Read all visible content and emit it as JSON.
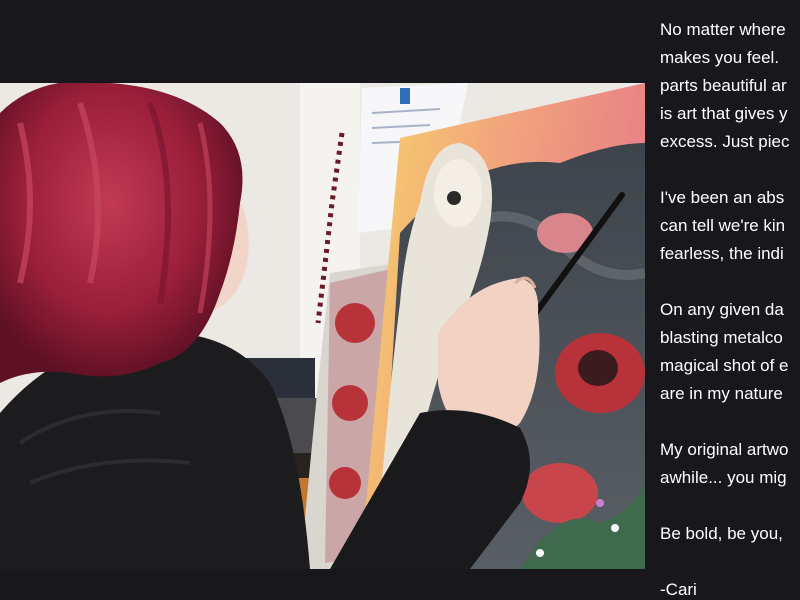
{
  "bio": {
    "paragraphs": [
      [
        "No matter where",
        "makes you feel.",
        "parts beautiful ar",
        "is art that gives y",
        "excess. Just piec"
      ],
      [
        "I've been an abs",
        "can tell we're kin",
        "fearless, the indi"
      ],
      [
        "On any given da",
        "blasting metalco",
        "magical shot of e",
        "are in my nature"
      ],
      [
        "My original artwo",
        "awhile... you mig"
      ],
      [
        "Be bold, be you,"
      ]
    ],
    "signature": "-Cari"
  },
  "photo": {
    "subject": "artist-painting-owl-canvas",
    "colors": {
      "hair": "#9b1f3a",
      "sweater": "#1a1a1c",
      "wall": "#e8e6e1",
      "canvas_sky": "#f2a07a",
      "owl": "#e9e4da",
      "mountain": "#4a4f55",
      "poppy": "#b8323a"
    }
  }
}
